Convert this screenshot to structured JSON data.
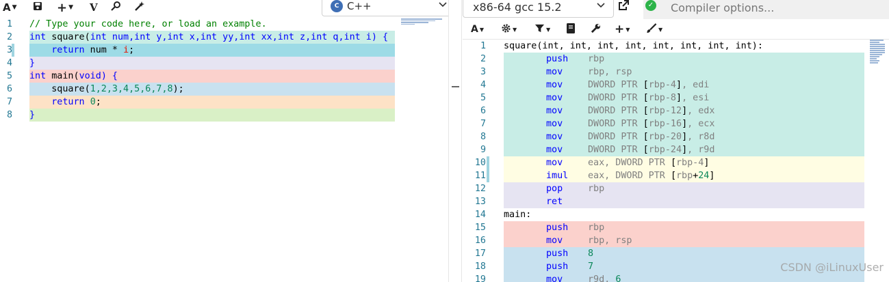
{
  "left_toolbar": {
    "font_btn": "A",
    "save_icon": "save-icon",
    "add_btn": "+",
    "vim_btn": "V",
    "language": "C++"
  },
  "source": {
    "lines": [
      {
        "n": "1",
        "bg": "#ffffff"
      },
      {
        "n": "2",
        "bg": "#c8ede6"
      },
      {
        "n": "3",
        "bg": "#9ddbe6"
      },
      {
        "n": "4",
        "bg": "#e6e4f2"
      },
      {
        "n": "5",
        "bg": "#fbd1cc"
      },
      {
        "n": "6",
        "bg": "#c8e1ef"
      },
      {
        "n": "7",
        "bg": "#fde2c6"
      },
      {
        "n": "8",
        "bg": "#d9f0c6"
      }
    ],
    "code": {
      "l1": "// Type your code here, or load an example.",
      "l2_int": "int",
      "l2_rest": " square(",
      "l2_params": "int num,int y,int x,int yy,int xx,int z,int q,int i) {",
      "l3_ret": "return",
      "l3_mid": " num * ",
      "l3_i": "i",
      "l3_end": ";",
      "l4": "}",
      "l5_int": "int",
      "l5_rest": " main(",
      "l5_void": "void",
      "l5_end": ") {",
      "l6_fn": "square(",
      "l6_args": "1,2,3,4,5,6,7,8",
      "l6_end": ");",
      "l7_ret": "return",
      "l7_zero": "0",
      "l7_end": ";",
      "l8": "}"
    }
  },
  "compiler": {
    "name": "x86-64 gcc 15.2",
    "options_placeholder": "Compiler options..."
  },
  "asm": {
    "lines": [
      {
        "n": "1",
        "bg": "#ffffff",
        "label": "square(int, int, int, int, int, int, int, int):",
        "op": "",
        "args": []
      },
      {
        "n": "2",
        "bg": "#c8ede6",
        "label": "",
        "op": "push",
        "args": [
          [
            "r",
            "rbp"
          ]
        ]
      },
      {
        "n": "3",
        "bg": "#c8ede6",
        "label": "",
        "op": "mov",
        "args": [
          [
            "r",
            "rbp, rsp"
          ]
        ]
      },
      {
        "n": "4",
        "bg": "#c8ede6",
        "label": "",
        "op": "mov",
        "args": [
          [
            "r",
            "DWORD PTR "
          ],
          [
            "b",
            "["
          ],
          [
            "r",
            "rbp-4"
          ],
          [
            "b",
            "]"
          ],
          [
            "r",
            ", edi"
          ]
        ]
      },
      {
        "n": "5",
        "bg": "#c8ede6",
        "label": "",
        "op": "mov",
        "args": [
          [
            "r",
            "DWORD PTR "
          ],
          [
            "b",
            "["
          ],
          [
            "r",
            "rbp-8"
          ],
          [
            "b",
            "]"
          ],
          [
            "r",
            ", esi"
          ]
        ]
      },
      {
        "n": "6",
        "bg": "#c8ede6",
        "label": "",
        "op": "mov",
        "args": [
          [
            "r",
            "DWORD PTR "
          ],
          [
            "b",
            "["
          ],
          [
            "r",
            "rbp-12"
          ],
          [
            "b",
            "]"
          ],
          [
            "r",
            ", edx"
          ]
        ]
      },
      {
        "n": "7",
        "bg": "#c8ede6",
        "label": "",
        "op": "mov",
        "args": [
          [
            "r",
            "DWORD PTR "
          ],
          [
            "b",
            "["
          ],
          [
            "r",
            "rbp-16"
          ],
          [
            "b",
            "]"
          ],
          [
            "r",
            ", ecx"
          ]
        ]
      },
      {
        "n": "8",
        "bg": "#c8ede6",
        "label": "",
        "op": "mov",
        "args": [
          [
            "r",
            "DWORD PTR "
          ],
          [
            "b",
            "["
          ],
          [
            "r",
            "rbp-20"
          ],
          [
            "b",
            "]"
          ],
          [
            "r",
            ", r8d"
          ]
        ]
      },
      {
        "n": "9",
        "bg": "#c8ede6",
        "label": "",
        "op": "mov",
        "args": [
          [
            "r",
            "DWORD PTR "
          ],
          [
            "b",
            "["
          ],
          [
            "r",
            "rbp-24"
          ],
          [
            "b",
            "]"
          ],
          [
            "r",
            ", r9d"
          ]
        ]
      },
      {
        "n": "10",
        "bg": "#fffde3",
        "label": "",
        "op": "mov",
        "args": [
          [
            "r",
            "eax, DWORD PTR "
          ],
          [
            "b",
            "["
          ],
          [
            "r",
            "rbp-4"
          ],
          [
            "b",
            "]"
          ]
        ]
      },
      {
        "n": "11",
        "bg": "#fffde3",
        "label": "",
        "op": "imul",
        "args": [
          [
            "r",
            "eax, DWORD PTR "
          ],
          [
            "b",
            "["
          ],
          [
            "r",
            "rbp"
          ],
          [
            "b",
            "+"
          ],
          [
            "n",
            "24"
          ],
          [
            "b",
            "]"
          ]
        ]
      },
      {
        "n": "12",
        "bg": "#e6e4f2",
        "label": "",
        "op": "pop",
        "args": [
          [
            "r",
            "rbp"
          ]
        ]
      },
      {
        "n": "13",
        "bg": "#e6e4f2",
        "label": "",
        "op": "ret",
        "args": []
      },
      {
        "n": "14",
        "bg": "#ffffff",
        "label": "main:",
        "op": "",
        "args": []
      },
      {
        "n": "15",
        "bg": "#fbd1cc",
        "label": "",
        "op": "push",
        "args": [
          [
            "r",
            "rbp"
          ]
        ]
      },
      {
        "n": "16",
        "bg": "#fbd1cc",
        "label": "",
        "op": "mov",
        "args": [
          [
            "r",
            "rbp, rsp"
          ]
        ]
      },
      {
        "n": "17",
        "bg": "#c8e1ef",
        "label": "",
        "op": "push",
        "args": [
          [
            "n",
            "8"
          ]
        ]
      },
      {
        "n": "18",
        "bg": "#c8e1ef",
        "label": "",
        "op": "push",
        "args": [
          [
            "n",
            "7"
          ]
        ]
      },
      {
        "n": "19",
        "bg": "#c8e1ef",
        "label": "",
        "op": "mov",
        "args": [
          [
            "r",
            "r9d, "
          ],
          [
            "n",
            "6"
          ]
        ]
      }
    ]
  },
  "watermark": "CSDN @iLinuxUser"
}
